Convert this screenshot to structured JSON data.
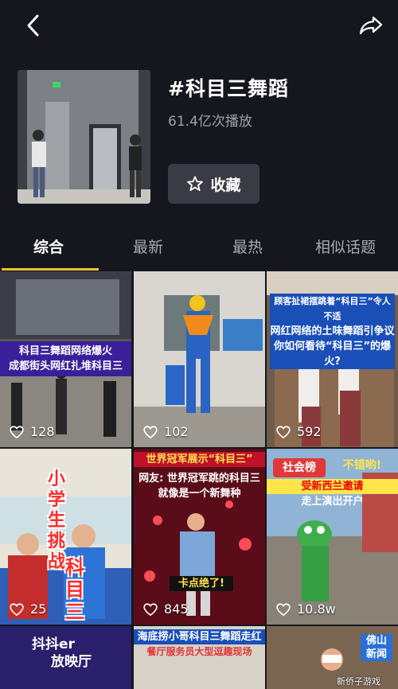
{
  "header": {
    "back_icon": "chevron-left-icon",
    "share_icon": "share-arrow-icon"
  },
  "topic": {
    "title": "#科目三舞蹈",
    "plays": "61.4亿次播放",
    "collect_label": "收藏"
  },
  "tabs": [
    {
      "label": "综合",
      "active": true
    },
    {
      "label": "最新",
      "active": false
    },
    {
      "label": "最热",
      "active": false
    },
    {
      "label": "相似话题",
      "active": false
    }
  ],
  "videos": [
    {
      "caption": [
        "科目三舞蹈网络爆火",
        "成都街头网红扎堆科目三"
      ],
      "likes": "128"
    },
    {
      "caption": [],
      "likes": "102"
    },
    {
      "caption": [
        "顾客扯裙摆跳着“科目三”令人不适",
        "网红网络的土味舞蹈引争议",
        "你如何看待“科目三”的爆火?"
      ],
      "likes": "592"
    },
    {
      "caption": [
        "小",
        "学",
        "生",
        "挑",
        "战",
        "科",
        "目",
        "三"
      ],
      "likes": "25"
    },
    {
      "caption": [
        "世界冠军展示“科目三”",
        "网友: 世界冠军跳的科目三",
        "就像是一个新舞种",
        "卡点绝了!"
      ],
      "likes": "845"
    },
    {
      "caption": [
        "社会榜",
        "不错哟!",
        "受新西兰邀请",
        "走上演出开户"
      ],
      "likes": "10.8w"
    },
    {
      "caption": [
        "抖抖er",
        "放映厅"
      ],
      "likes": ""
    },
    {
      "caption": [
        "海底捞小哥科目三舞蹈走红",
        "餐厅服务员大型逗趣现场"
      ],
      "likes": ""
    },
    {
      "caption": [
        "佛山",
        "新闻"
      ],
      "likes": ""
    }
  ],
  "watermark": "新侨子游戏"
}
